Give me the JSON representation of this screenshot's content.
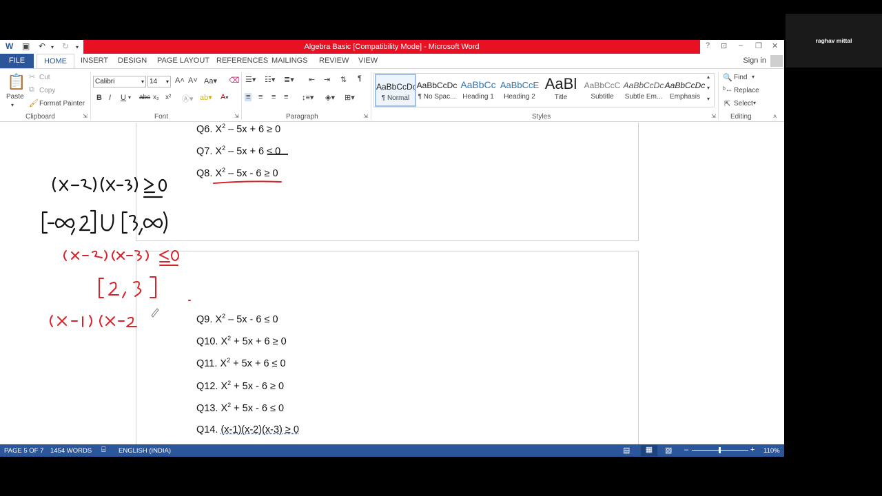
{
  "window": {
    "title": "Algebra Basic [Compatibility Mode] -  Microsoft Word"
  },
  "participant": {
    "name": "raghav mittal"
  },
  "menu": {
    "file": "FILE",
    "tabs": [
      "HOME",
      "INSERT",
      "DESIGN",
      "PAGE LAYOUT",
      "REFERENCES",
      "MAILINGS",
      "REVIEW",
      "VIEW"
    ],
    "active": "HOME",
    "sign_in": "Sign in"
  },
  "ribbon": {
    "clipboard": {
      "paste": "Paste",
      "cut": "Cut",
      "copy": "Copy",
      "format_painter": "Format Painter",
      "label": "Clipboard"
    },
    "font": {
      "name": "Calibri",
      "size": "14",
      "label": "Font"
    },
    "paragraph": {
      "label": "Paragraph"
    },
    "styles": {
      "label": "Styles",
      "items": [
        {
          "sample": "AaBbCcDc",
          "name": "¶ Normal"
        },
        {
          "sample": "AaBbCcDc",
          "name": "¶ No Spac..."
        },
        {
          "sample": "AaBbCc",
          "name": "Heading 1"
        },
        {
          "sample": "AaBbCcE",
          "name": "Heading 2"
        },
        {
          "sample": "AaBl",
          "name": "Title"
        },
        {
          "sample": "AaBbCcC",
          "name": "Subtitle"
        },
        {
          "sample": "AaBbCcDc",
          "name": "Subtle Em..."
        },
        {
          "sample": "AaBbCcDc",
          "name": "Emphasis"
        }
      ]
    },
    "editing": {
      "find": "Find",
      "replace": "Replace",
      "select": "Select",
      "label": "Editing"
    }
  },
  "document": {
    "questions_page1": [
      {
        "num": "Q6.",
        "base": "X",
        "rest": " – 5x + 6 ≥ 0"
      },
      {
        "num": "Q7.",
        "base": "X",
        "rest": " – 5x + 6 ≤ 0"
      },
      {
        "num": "Q8.",
        "base": "X",
        "rest": " – 5x - 6 ≥ 0"
      }
    ],
    "questions_page2": [
      {
        "num": "Q9.",
        "base": "X",
        "rest": " – 5x - 6 ≤ 0"
      },
      {
        "num": "Q10.",
        "base": "X",
        "rest": " + 5x + 6 ≥ 0"
      },
      {
        "num": "Q11.",
        "base": "X",
        "rest": " + 5x + 6 ≤ 0"
      },
      {
        "num": "Q12.",
        "base": "X",
        "rest": " + 5x - 6 ≥ 0"
      },
      {
        "num": "Q13.",
        "base": "X",
        "rest": " + 5x - 6 ≤ 0"
      }
    ],
    "q14": {
      "num": "Q14.",
      "text": "(x-1)(x-2)(x-3) ≥ 0"
    },
    "exponent": "2"
  },
  "status": {
    "page": "PAGE 5 OF 7",
    "words": "1454 WORDS",
    "language": "ENGLISH (INDIA)",
    "zoom": "110%"
  },
  "colors": {
    "accent": "#2b579a",
    "title_red": "#e81123",
    "ink_black": "#111111",
    "ink_red": "#d8232a"
  }
}
